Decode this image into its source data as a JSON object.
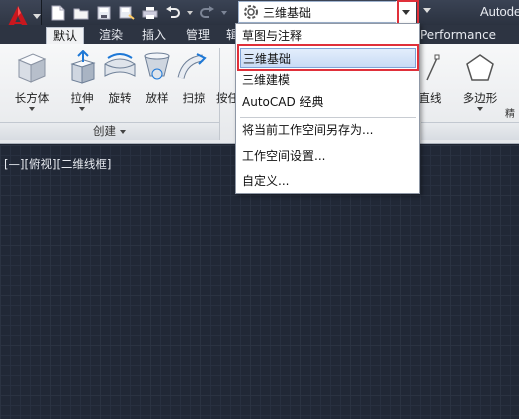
{
  "window": {
    "app_title": "Autode"
  },
  "quick_access": {
    "workspace_combo_value": "三维基础"
  },
  "tabs": [
    {
      "label": "默认"
    },
    {
      "label": "渲染"
    },
    {
      "label": "插入"
    },
    {
      "label": "管理"
    },
    {
      "label": "辑"
    },
    {
      "label": "Performance"
    }
  ],
  "ribbon": {
    "tools": [
      {
        "label": "长方体",
        "has_dropdown": true
      },
      {
        "label": "拉伸",
        "has_dropdown": true
      },
      {
        "label": "旋转"
      },
      {
        "label": "放样"
      },
      {
        "label": "扫掠"
      },
      {
        "label": "按任"
      },
      {
        "label": "直线"
      },
      {
        "label": "多边形"
      }
    ],
    "panel_title": "创建",
    "right_fragment": "精"
  },
  "workspace_menu": {
    "items": [
      {
        "label": "草图与注释",
        "selected": false
      },
      {
        "label": "三维基础",
        "selected": true
      },
      {
        "label": "三维建模",
        "selected": false
      },
      {
        "label": "AutoCAD 经典",
        "selected": false
      }
    ],
    "actions": [
      {
        "label": "将当前工作空间另存为..."
      },
      {
        "label": "工作空间设置..."
      },
      {
        "label": "自定义..."
      }
    ]
  },
  "canvas": {
    "viewport_label": "[—][俯视][二维线框]"
  },
  "colors": {
    "highlight_red": "#e0303a",
    "canvas_bg": "#212836",
    "selection_blue": "#c9dcf5"
  }
}
